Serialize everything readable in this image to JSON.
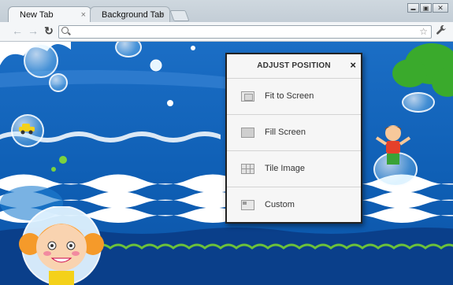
{
  "browser": {
    "tabs": [
      {
        "label": "New Tab",
        "close": "×"
      },
      {
        "label": "Background Tab",
        "close": "×"
      }
    ],
    "window_controls": {
      "minimize": "▬",
      "restore": "▣",
      "close": "✕"
    },
    "toolbar": {
      "back": "←",
      "forward": "→",
      "reload": "↻",
      "address": "",
      "star": "☆",
      "wrench": "🔧"
    }
  },
  "panel": {
    "title": "ADJUST POSITION",
    "close": "×",
    "options": [
      {
        "label": "Fit to Screen",
        "icon": "fit-to-screen-icon"
      },
      {
        "label": "Fill Screen",
        "icon": "fill-screen-icon"
      },
      {
        "label": "Tile Image",
        "icon": "tile-image-icon"
      },
      {
        "label": "Custom",
        "icon": "custom-position-icon"
      }
    ]
  },
  "colors": {
    "sky": "#1b6ec5",
    "sea_dark": "#0c55a8",
    "grass": "#4caf30",
    "tree": "#39a82a"
  }
}
